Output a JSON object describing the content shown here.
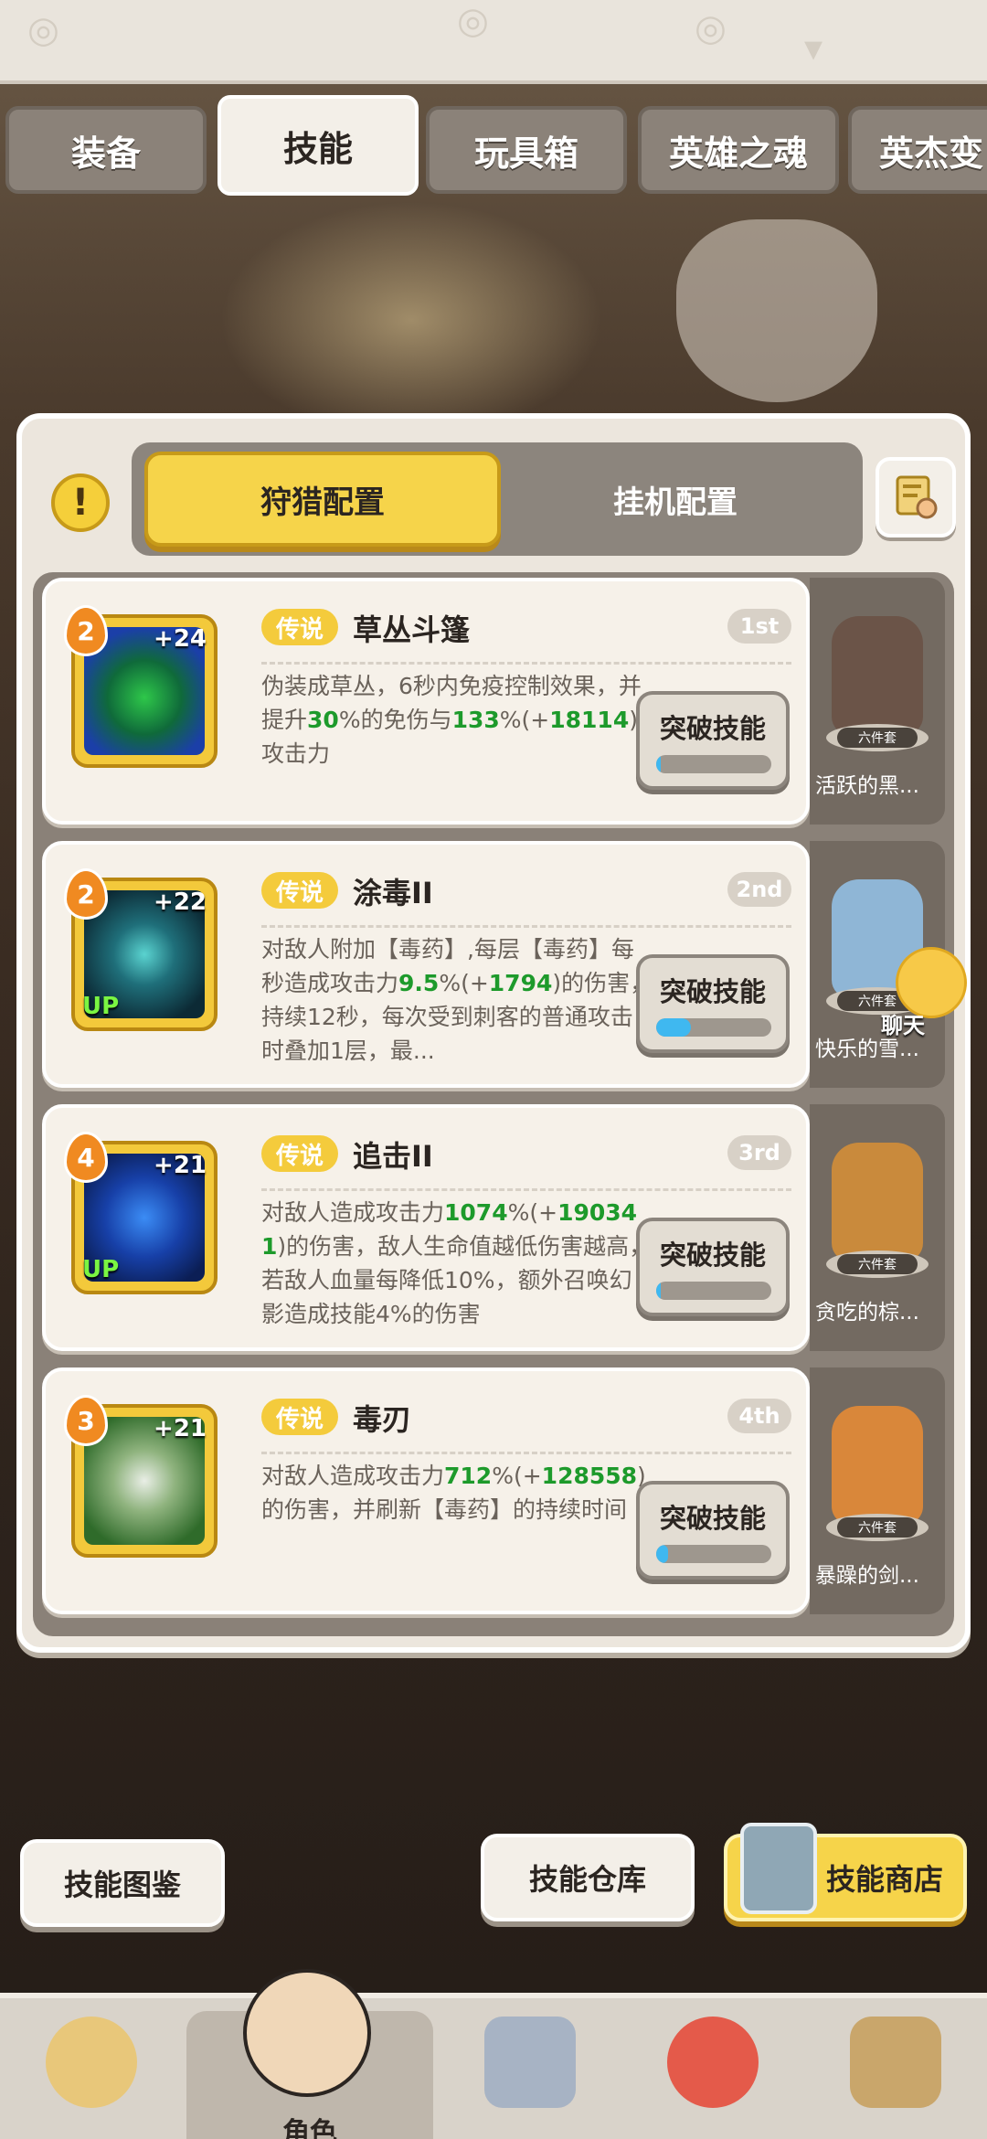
{
  "tabs": [
    {
      "label": "装备",
      "active": false
    },
    {
      "label": "技能",
      "active": true
    },
    {
      "label": "玩具箱",
      "active": false
    },
    {
      "label": "英雄之魂",
      "active": false
    },
    {
      "label": "英杰变",
      "active": false
    }
  ],
  "config": {
    "info_icon": "!",
    "hunt_label": "狩猎配置",
    "idle_label": "挂机配置"
  },
  "skills": [
    {
      "level": "2",
      "plus": "+24",
      "up": "",
      "rarity": "传说",
      "name": "草丛斗篷",
      "rank": "1st",
      "desc": [
        {
          "t": "伪装成草丛，6秒内免疫控制效果，并提升",
          "h": false
        },
        {
          "t": "30",
          "h": true
        },
        {
          "t": "%的免伤与",
          "h": false
        },
        {
          "t": "133",
          "h": true
        },
        {
          "t": "%(+",
          "h": false
        },
        {
          "t": "18114",
          "h": true
        },
        {
          "t": ")攻击力",
          "h": false
        }
      ],
      "button": "突破技能",
      "progress": 0.03
    },
    {
      "level": "2",
      "plus": "+22",
      "up": "UP",
      "rarity": "传说",
      "name": "涂毒II",
      "rank": "2nd",
      "desc": [
        {
          "t": "对敌人附加【毒药】,每层【毒药】每秒造成攻击力",
          "h": false
        },
        {
          "t": "9.5",
          "h": true
        },
        {
          "t": "%(+",
          "h": false
        },
        {
          "t": "1794",
          "h": true
        },
        {
          "t": ")的伤害，持续12秒，每次受到刺客的普通攻击时叠加1层，最...",
          "h": false
        }
      ],
      "button": "突破技能",
      "progress": 0.3
    },
    {
      "level": "4",
      "plus": "+21",
      "up": "UP",
      "rarity": "传说",
      "name": "追击II",
      "rank": "3rd",
      "desc": [
        {
          "t": "对敌人造成攻击力",
          "h": false
        },
        {
          "t": "1074",
          "h": true
        },
        {
          "t": "%(+",
          "h": false
        },
        {
          "t": "190341",
          "h": true
        },
        {
          "t": ")的伤害，敌人生命值越低伤害越高，若敌人血量每降低10%，额外召唤幻影造成技能4%的伤害",
          "h": false
        }
      ],
      "button": "突破技能",
      "progress": 0.03
    },
    {
      "level": "3",
      "plus": "+21",
      "up": "",
      "rarity": "传说",
      "name": "毒刃",
      "rank": "4th",
      "desc": [
        {
          "t": "对敌人造成攻击力",
          "h": false
        },
        {
          "t": "712",
          "h": true
        },
        {
          "t": "%(+",
          "h": false
        },
        {
          "t": "128558",
          "h": true
        },
        {
          "t": ")的伤害，并刷新【毒药】的持续时间",
          "h": false
        }
      ],
      "button": "突破技能",
      "progress": 0.1
    }
  ],
  "sets": [
    {
      "name": "活跃的黑...",
      "badge": "六件套",
      "color": "#6b5448"
    },
    {
      "name": "快乐的雪...",
      "badge": "六件套",
      "color": "#8fb6d6"
    },
    {
      "name": "贪吃的棕...",
      "badge": "六件套",
      "color": "#c98a3c"
    },
    {
      "name": "暴躁的剑...",
      "badge": "六件套",
      "color": "#d9873a"
    }
  ],
  "chat_label": "聊天",
  "bottom_buttons": {
    "atlas": "技能图鉴",
    "warehouse": "技能仓库",
    "shop": "技能商店"
  },
  "nav": [
    {
      "label": "",
      "icon": "horned-helmet-icon",
      "active": false
    },
    {
      "label": "角色",
      "icon": "hero-avatar-icon",
      "active": true
    },
    {
      "label": "",
      "icon": "sword-icon",
      "active": false
    },
    {
      "label": "",
      "icon": "pet-dino-icon",
      "active": false
    },
    {
      "label": "",
      "icon": "totem-icon",
      "active": false
    }
  ]
}
